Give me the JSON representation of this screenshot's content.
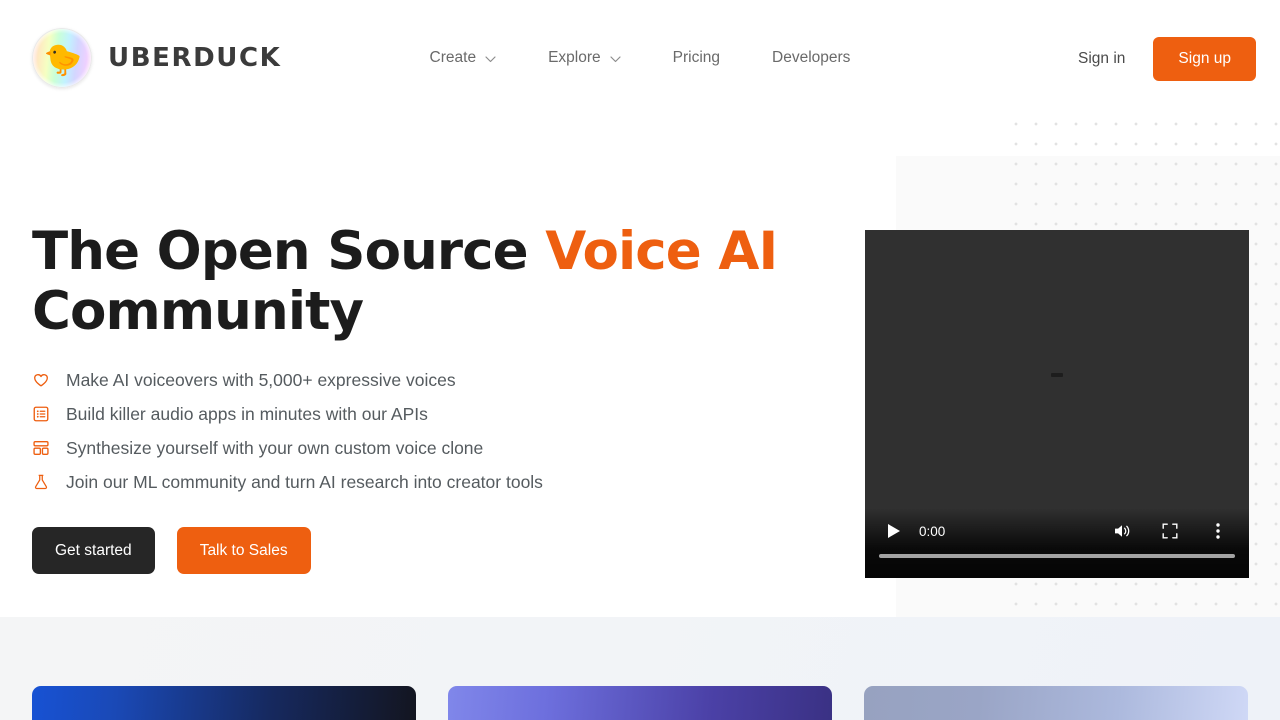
{
  "brand": {
    "name": "UBERDUCK",
    "logo_icon": "duck-icon",
    "logo_glyph": "🐤"
  },
  "nav": {
    "items": [
      {
        "label": "Create",
        "has_dropdown": true,
        "icon": "chevron-down-icon"
      },
      {
        "label": "Explore",
        "has_dropdown": true,
        "icon": "chevron-down-icon"
      },
      {
        "label": "Pricing",
        "has_dropdown": false,
        "icon": ""
      },
      {
        "label": "Developers",
        "has_dropdown": false,
        "icon": ""
      }
    ]
  },
  "auth": {
    "sign_in_label": "Sign in",
    "sign_up_label": "Sign up",
    "sign_up_color": "#ee5f10"
  },
  "hero": {
    "title_part1": "The Open Source ",
    "title_accent": "Voice AI",
    "title_part2": "Community",
    "accent_color": "#ee5f10",
    "features": [
      {
        "icon": "heart-icon",
        "text": "Make AI voiceovers with 5,000+ expressive voices"
      },
      {
        "icon": "list-box-icon",
        "text": "Build killer audio apps in minutes with our APIs"
      },
      {
        "icon": "layout-icon",
        "text": "Synthesize yourself with your own custom voice clone"
      },
      {
        "icon": "flask-icon",
        "text": "Join our ML community and turn AI research into creator tools"
      }
    ],
    "cta": {
      "primary_label": "Get started",
      "secondary_label": "Talk to Sales",
      "primary_color": "#262626",
      "secondary_color": "#ee5f10"
    }
  },
  "video": {
    "play_icon": "play-icon",
    "current_time": "0:00",
    "volume_icon": "volume-icon",
    "fullscreen_icon": "fullscreen-icon",
    "more_icon": "more-vertical-icon",
    "poster_state": "broken-image-placeholder",
    "progress_percent": 0
  },
  "lower_cards": [
    {
      "name": "card-1",
      "gradient_from": "#1752d4",
      "gradient_to": "#131520"
    },
    {
      "name": "card-2",
      "gradient_from": "#8087ea",
      "gradient_to": "#3a3184"
    },
    {
      "name": "card-3",
      "gradient_from": "#97a2c0",
      "gradient_to": "#cfd8f6"
    }
  ]
}
